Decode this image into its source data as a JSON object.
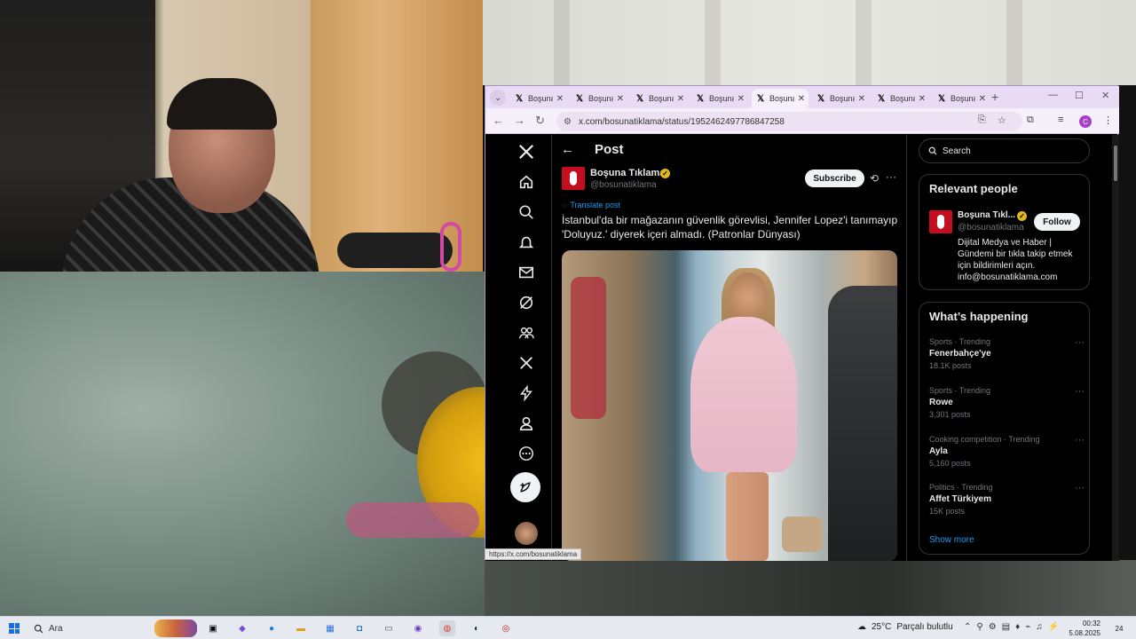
{
  "browser": {
    "tabs": [
      {
        "label": "Boşuna"
      },
      {
        "label": "Boşuna"
      },
      {
        "label": "Boşuna"
      },
      {
        "label": "Boşuna"
      },
      {
        "label": "Boşuna"
      },
      {
        "label": "Boşuna"
      },
      {
        "label": "Boşuna"
      },
      {
        "label": "Boşuna"
      }
    ],
    "active_tab_index": 4,
    "url": "x.com/bosunatiklama/status/1952462497786847258",
    "status_link": "https://x.com/bosunatiklama"
  },
  "post": {
    "header_title": "Post",
    "author_name": "Boşuna Tıklama",
    "author_handle": "@bosunatiklama",
    "subscribe_label": "Subscribe",
    "translate_label": "Translate post",
    "text": "İstanbul'da bir mağazanın güvenlik görevlisi, Jennifer Lopez'i tanımayıp 'Doluyuz.' diyerek içeri almadı. (Patronlar Dünyası)"
  },
  "sidebar": {
    "search_placeholder": "Search",
    "relevant": {
      "title": "Relevant people",
      "name": "Boşuna Tıkl...",
      "handle": "@bosunatiklama",
      "follow_label": "Follow",
      "bio": "Dijital Medya ve Haber | Gündemi bir tıkla takip etmek için bildirimleri açın. info@bosunatiklama.com"
    },
    "happening": {
      "title": "What’s happening",
      "trends": [
        {
          "meta": "Sports · Trending",
          "name": "Fenerbahçe'ye",
          "count": "18.1K posts"
        },
        {
          "meta": "Sports · Trending",
          "name": "Rowe",
          "count": "3,301 posts"
        },
        {
          "meta": "Cooking competition · Trending",
          "name": "Ayla",
          "count": "5,160 posts"
        },
        {
          "meta": "Politics · Trending",
          "name": "Affet Türkiyem",
          "count": "15K posts"
        }
      ],
      "show_more": "Show more"
    }
  },
  "taskbar": {
    "search_label": "Ara",
    "weather": "25°C",
    "weather_text": "Parçalı bulutlu",
    "time": "00:32",
    "date": "5.08.2025",
    "notifications": "24"
  }
}
